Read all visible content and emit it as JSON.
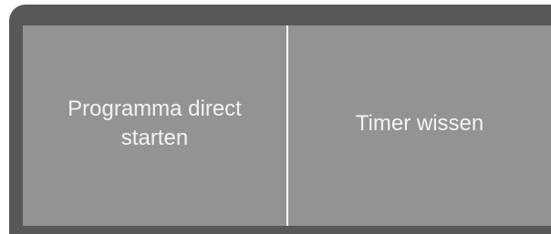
{
  "buttons": {
    "start_program_now": "Programma direct\nstarten",
    "clear_timer": "Timer wissen"
  },
  "colors": {
    "frame": "#58585a",
    "screen": "#939395",
    "text": "#f3f3f3",
    "divider": "#ffffff"
  }
}
